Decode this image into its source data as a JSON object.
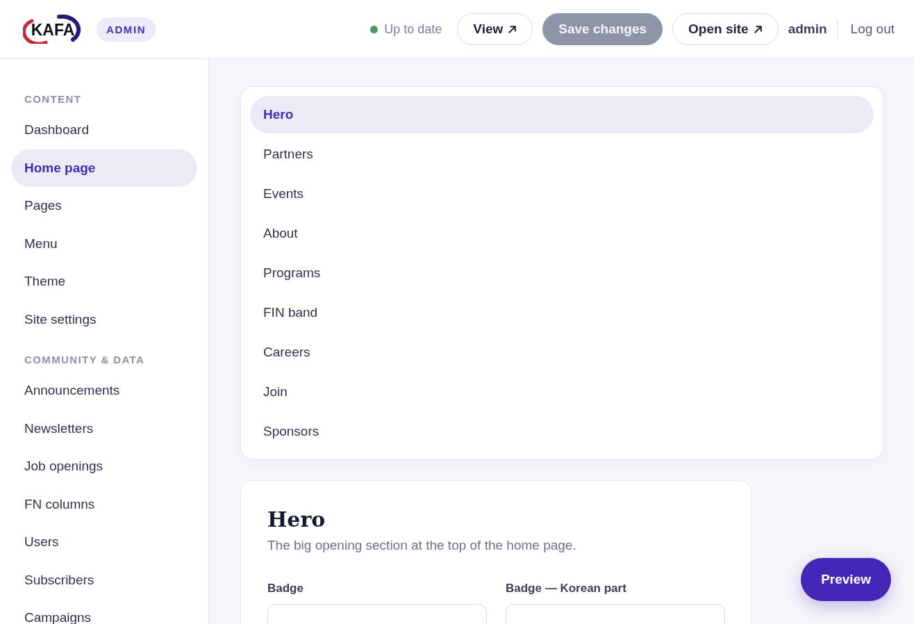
{
  "header": {
    "logo": "KAFA",
    "badge": "ADMIN",
    "status": {
      "label": "Up to date",
      "kind": "synced"
    },
    "actions": [
      {
        "label": "View",
        "kind": "external",
        "disabled": false
      },
      {
        "label": "Save changes",
        "kind": "primary",
        "disabled": true
      },
      {
        "label": "Open site",
        "kind": "external",
        "disabled": false
      }
    ],
    "user": "admin",
    "logout": "Log out"
  },
  "sidebar": {
    "groups": [
      {
        "heading": "CONTENT",
        "items": [
          {
            "label": "Dashboard",
            "selected": false
          },
          {
            "label": "Home page",
            "selected": true
          },
          {
            "label": "Pages",
            "selected": false
          },
          {
            "label": "Menu",
            "selected": false
          },
          {
            "label": "Theme",
            "selected": false
          },
          {
            "label": "Site settings",
            "selected": false
          }
        ]
      },
      {
        "heading": "COMMUNITY & DATA",
        "items": [
          {
            "label": "Announcements",
            "selected": false
          },
          {
            "label": "Newsletters",
            "selected": false
          },
          {
            "label": "Job openings",
            "selected": false
          },
          {
            "label": "FN columns",
            "selected": false
          },
          {
            "label": "Users",
            "selected": false
          },
          {
            "label": "Subscribers",
            "selected": false
          },
          {
            "label": "Campaigns",
            "selected": false
          }
        ]
      }
    ]
  },
  "sections": [
    {
      "label": "Hero",
      "selected": true
    },
    {
      "label": "Partners",
      "selected": false
    },
    {
      "label": "Events",
      "selected": false
    },
    {
      "label": "About",
      "selected": false
    },
    {
      "label": "Programs",
      "selected": false
    },
    {
      "label": "FIN band",
      "selected": false
    },
    {
      "label": "Careers",
      "selected": false
    },
    {
      "label": "Join",
      "selected": false
    },
    {
      "label": "Sponsors",
      "selected": false
    }
  ],
  "editor": {
    "title": "Hero",
    "description": "The big opening section at the top of the home page.",
    "fields": [
      {
        "label": "Badge"
      },
      {
        "label": "Badge — Korean part"
      }
    ]
  },
  "preview_button": "Preview"
}
